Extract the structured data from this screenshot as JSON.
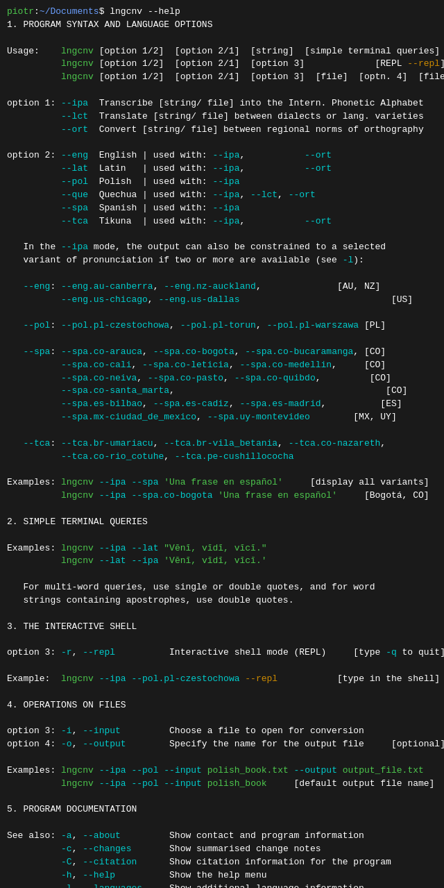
{
  "terminal": {
    "prompt_user": "piotr",
    "prompt_path": "~/Documents",
    "prompt_symbol": "$",
    "command": " lngcnv --help",
    "lines": []
  }
}
